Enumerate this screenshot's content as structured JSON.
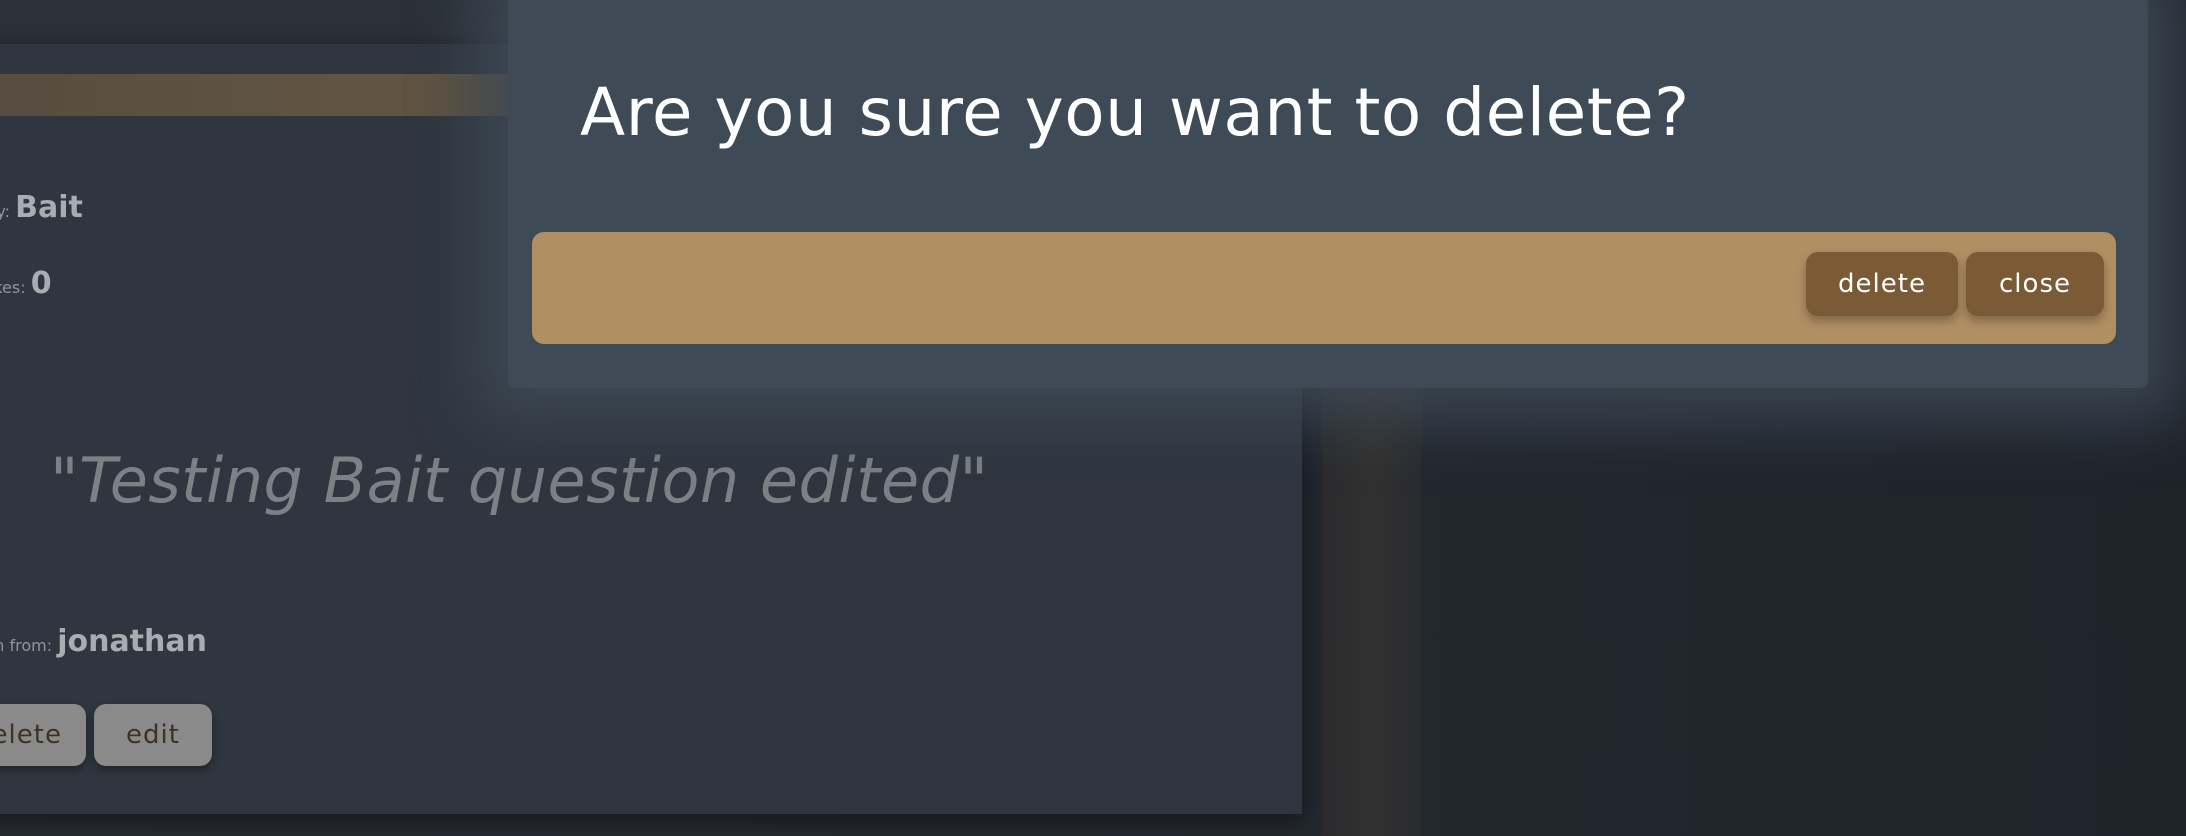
{
  "background": {
    "category_label": "ory:",
    "category_value": "Bait",
    "likes_label": "Likes:",
    "likes_value": "0",
    "question": "\"Testing Bait question edited\"",
    "from_label": "ion from:",
    "from_value": "jonathan",
    "delete_label": "delete",
    "edit_label": "edit"
  },
  "modal": {
    "title": "Are you sure you want to delete?",
    "delete_label": "delete",
    "close_label": "close"
  },
  "colors": {
    "modal_bg": "#3e4a56",
    "footer_bg": "#b08f63",
    "button_bg": "#7a5b36",
    "card_bg": "#2f363f"
  }
}
